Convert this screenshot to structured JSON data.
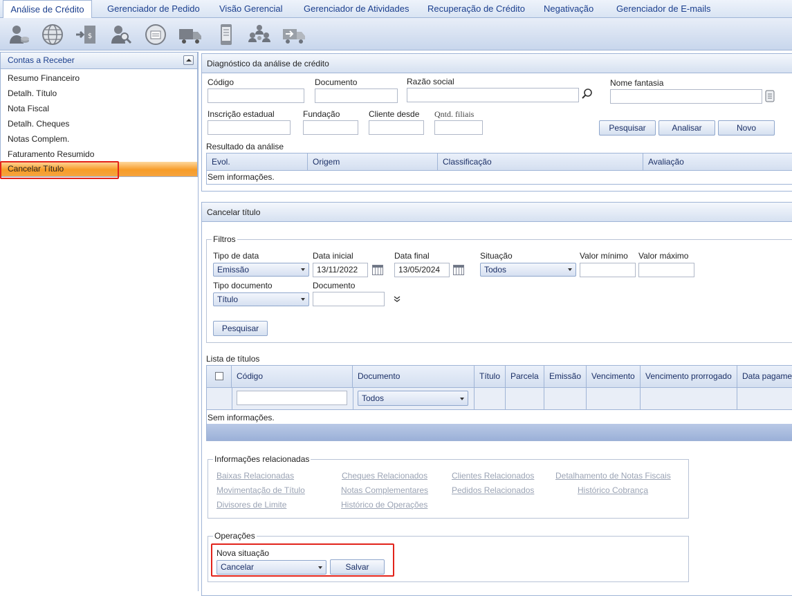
{
  "tabs": [
    {
      "label": "Análise de Crédito"
    },
    {
      "label": "Gerenciador de Pedido"
    },
    {
      "label": "Visão Gerencial"
    },
    {
      "label": "Gerenciador de Atividades"
    },
    {
      "label": "Recuperação de Crédito"
    },
    {
      "label": "Negativação"
    },
    {
      "label": "Gerenciador de E-mails"
    }
  ],
  "toolbar_icons": [
    "user-money-icon",
    "globe-icon",
    "door-money-icon",
    "user-search-icon",
    "web-document-icon",
    "truck-icon",
    "mobile-document-icon",
    "group-users-icon",
    "truck-arrow-icon"
  ],
  "sidebar": {
    "title": "Contas a Receber",
    "items": [
      {
        "label": "Resumo Financeiro"
      },
      {
        "label": "Detalh. Título"
      },
      {
        "label": "Nota Fiscal"
      },
      {
        "label": "Detalh. Cheques"
      },
      {
        "label": "Notas Complem."
      },
      {
        "label": "Faturamento Resumido"
      },
      {
        "label": "Cancelar Título"
      }
    ],
    "active_index": 6
  },
  "diagnostico": {
    "title": "Diagnóstico da análise de crédito",
    "codigo_label": "Código",
    "documento_label": "Documento",
    "razao_label": "Razão social",
    "nome_fantasia_label": "Nome fantasia",
    "inscricao_label": "Inscrição estadual",
    "fundacao_label": "Fundação",
    "cliente_desde_label": "Cliente desde",
    "qntd_filiais_label": "Qntd. filiais",
    "pesquisar": "Pesquisar",
    "analisar": "Analisar",
    "novo": "Novo",
    "resultado_label": "Resultado da análise",
    "columns": [
      "Evol.",
      "Origem",
      "Classificação",
      "Avaliação"
    ],
    "empty": "Sem informações."
  },
  "cancelar": {
    "title": "Cancelar título",
    "filtros_legend": "Filtros",
    "tipo_data_label": "Tipo de data",
    "tipo_data_value": "Emissão",
    "data_inicial_label": "Data inicial",
    "data_inicial_value": "13/11/2022",
    "data_final_label": "Data final",
    "data_final_value": "13/05/2024",
    "situacao_label": "Situação",
    "situacao_value": "Todos",
    "valor_min_label": "Valor mínimo",
    "valor_max_label": "Valor máximo",
    "tipo_doc_label": "Tipo documento",
    "tipo_doc_value": "Título",
    "documento_label": "Documento",
    "pesquisar": "Pesquisar",
    "lista_label": "Lista de títulos",
    "columns": [
      "Código",
      "Documento",
      "Título",
      "Parcela",
      "Emissão",
      "Vencimento",
      "Vencimento prorrogado",
      "Data pagame"
    ],
    "documento_filter_value": "Todos",
    "empty": "Sem informações.",
    "info_legend": "Informações relacionadas",
    "links": [
      "Baixas Relacionadas",
      "Cheques Relacionados",
      "Clientes Relacionados",
      "Detalhamento de Notas Fiscais",
      "Movimentação de Título",
      "Notas Complementares",
      "Pedidos Relacionados",
      "Histórico Cobrança",
      "Divisores de Limite",
      "Histórico de Operações"
    ],
    "operacoes_legend": "Operações",
    "nova_situacao_label": "Nova situação",
    "nova_situacao_value": "Cancelar",
    "salvar": "Salvar"
  }
}
